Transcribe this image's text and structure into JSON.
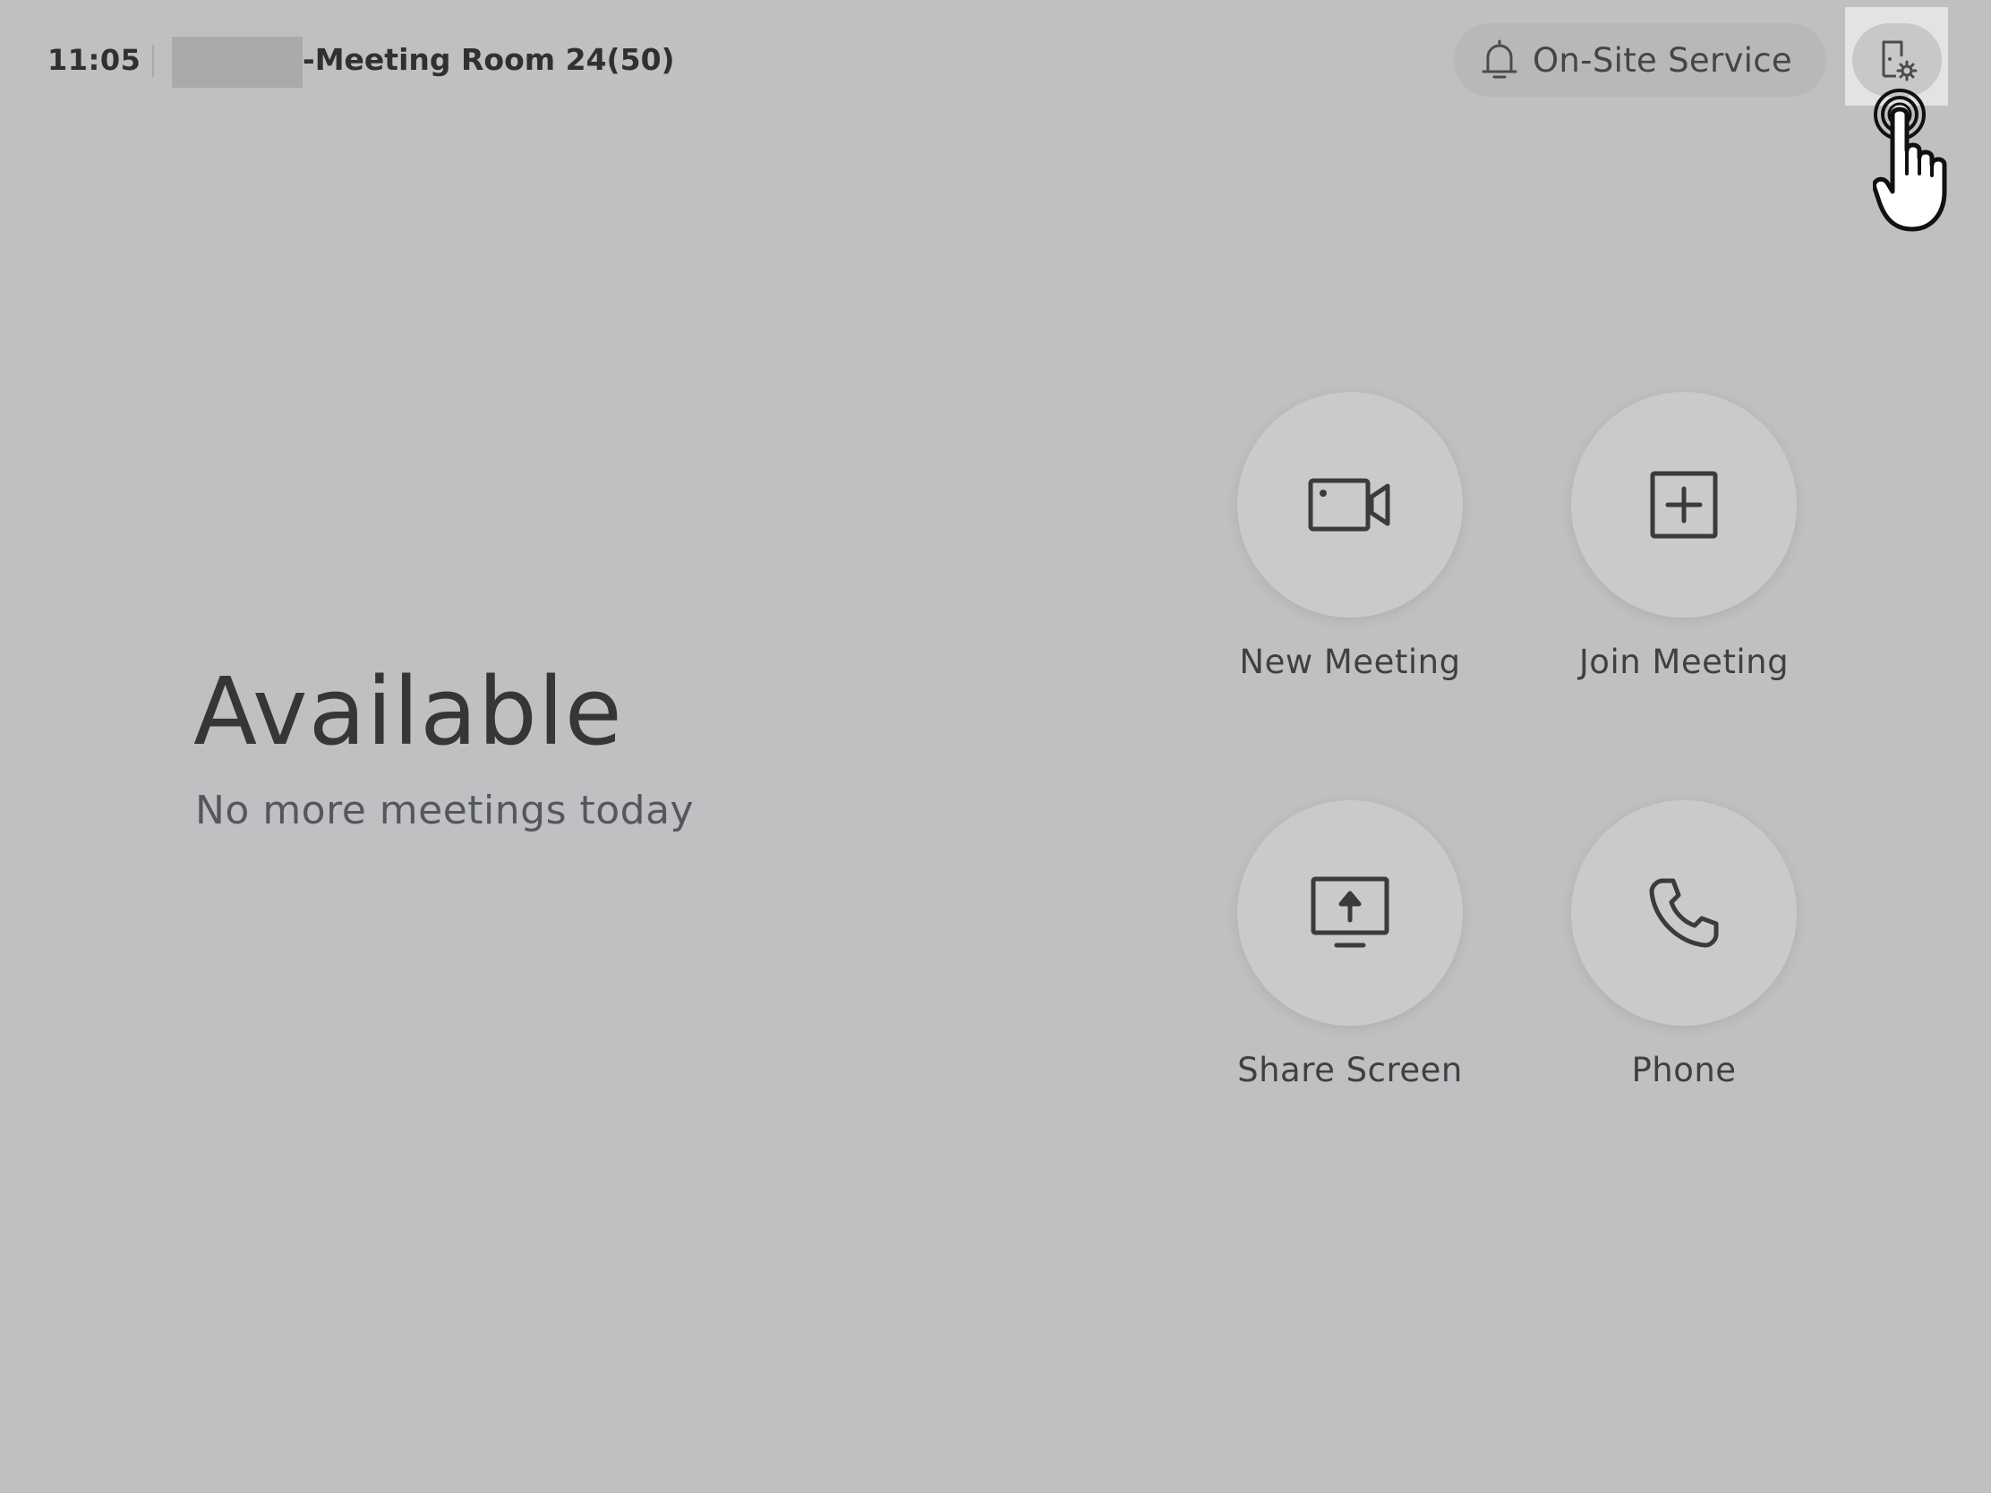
{
  "header": {
    "time": "11:05",
    "room_name": "-Meeting Room 24(50)",
    "on_site_service_label": "On-Site Service",
    "icons": {
      "on_site_service": "bell-icon",
      "settings": "device-settings-icon",
      "cursor": "hand-pointer-cursor-icon"
    }
  },
  "status": {
    "title": "Available",
    "subtitle": "No more meetings today"
  },
  "actions": [
    {
      "label": "New Meeting",
      "icon": "video-camera-icon"
    },
    {
      "label": "Join Meeting",
      "icon": "plus-square-icon"
    },
    {
      "label": "Share Screen",
      "icon": "share-screen-icon"
    },
    {
      "label": "Phone",
      "icon": "phone-icon"
    }
  ],
  "colors": {
    "background": "#bfc0c2",
    "button": "#c9cacb",
    "text": "#3b3c3e"
  }
}
